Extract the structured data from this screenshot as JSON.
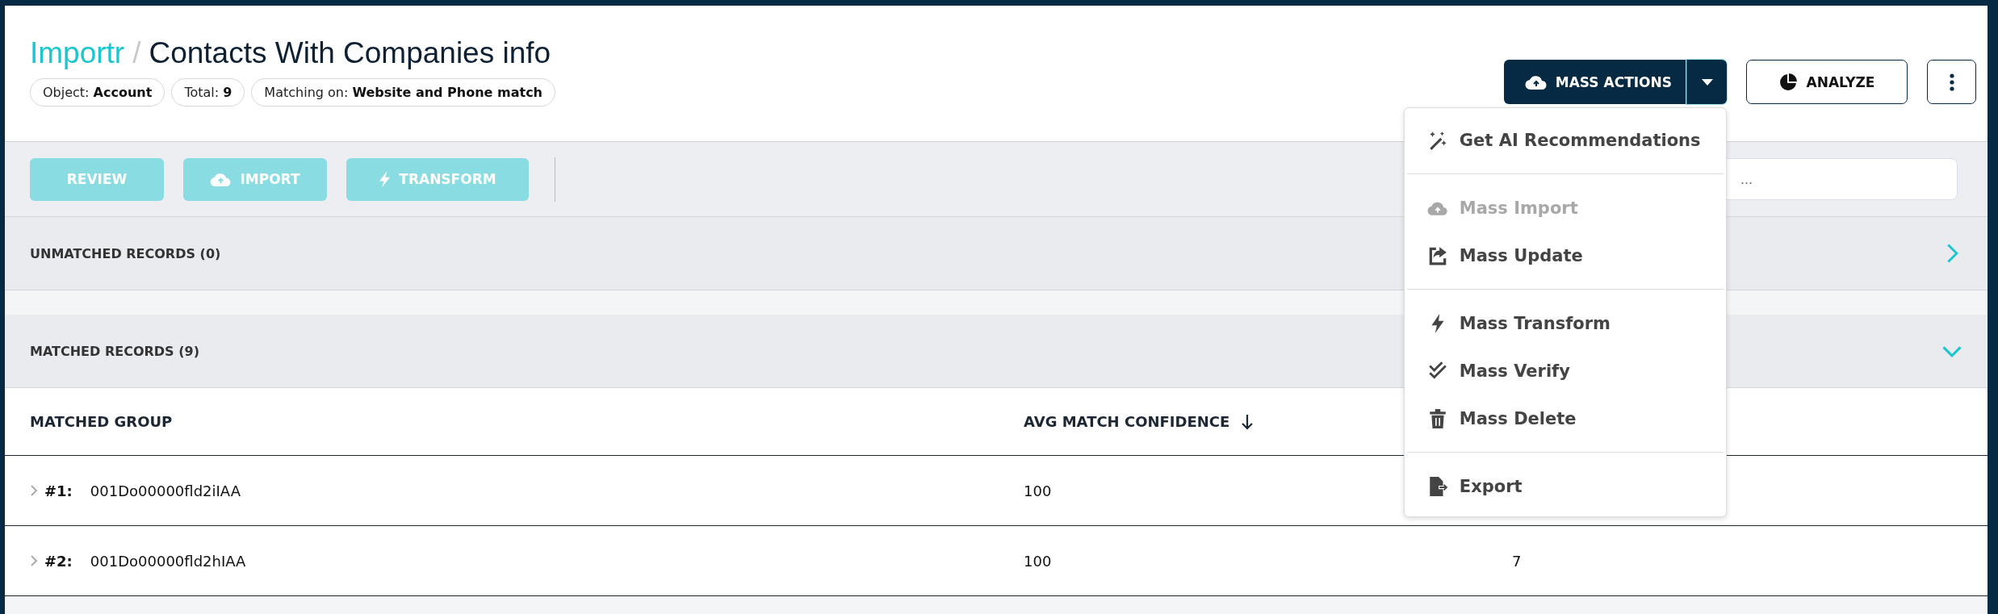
{
  "header": {
    "brand": "Importr",
    "separator": "/",
    "title": "Contacts With Companies info",
    "chips": [
      {
        "label": "Object:",
        "value": "Account"
      },
      {
        "label": "Total:",
        "value": "9"
      },
      {
        "label": "Matching on:",
        "value": "Website and Phone match"
      }
    ]
  },
  "actions": {
    "mass_actions": {
      "label": "MASS ACTIONS",
      "expanded": true
    },
    "analyze": "ANALYZE"
  },
  "menu": [
    {
      "kind": "item",
      "label": "Get AI Recommendations",
      "disabled": false
    },
    {
      "kind": "divider"
    },
    {
      "kind": "item",
      "label": "Mass Import",
      "disabled": true
    },
    {
      "kind": "item",
      "label": "Mass Update",
      "disabled": false
    },
    {
      "kind": "divider"
    },
    {
      "kind": "item",
      "label": "Mass Transform",
      "disabled": false
    },
    {
      "kind": "item",
      "label": "Mass Verify",
      "disabled": false
    },
    {
      "kind": "item",
      "label": "Mass Delete",
      "disabled": false
    },
    {
      "kind": "divider"
    },
    {
      "kind": "item",
      "label": "Export",
      "disabled": false
    }
  ],
  "toolbar": {
    "buttons": [
      {
        "label": "REVIEW",
        "disabled": true
      },
      {
        "label": "IMPORT",
        "disabled": true
      },
      {
        "label": "TRANSFORM",
        "disabled": true
      }
    ],
    "search": {
      "placeholder": "..."
    }
  },
  "sections": [
    {
      "title": "UNMATCHED RECORDS (0)",
      "expanded": false
    },
    {
      "title": "MATCHED RECORDS (9)",
      "expanded": true
    }
  ],
  "table": {
    "columns": [
      {
        "label": "MATCHED GROUP"
      },
      {
        "label": "AVG MATCH CONFIDENCE",
        "sorted": true
      }
    ],
    "rows": [
      {
        "expanded": false,
        "number": "#1:",
        "id": "001Do00000fld2iIAA",
        "confidence": "100"
      },
      {
        "expanded": false,
        "number": "#2:",
        "id": "001Do00000fld2hIAA",
        "confidence": "100",
        "column_3": "7"
      }
    ]
  }
}
